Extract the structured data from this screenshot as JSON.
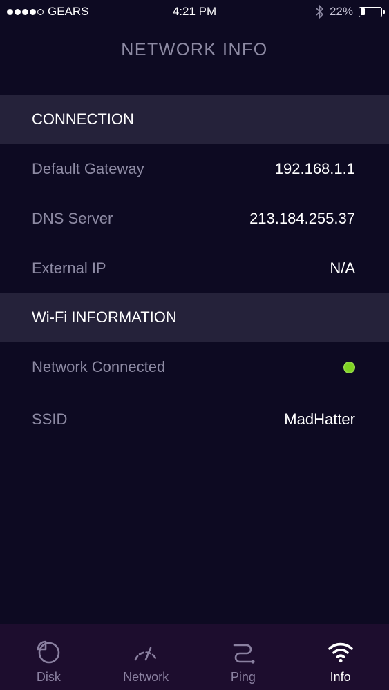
{
  "status_bar": {
    "carrier": "GEARS",
    "time": "4:21 PM",
    "battery_percent": "22%",
    "battery_level": 0.22,
    "signal_bars_filled": 4,
    "signal_bars_total": 5,
    "bluetooth_icon": "bluetooth-icon"
  },
  "header": {
    "title": "NETWORK INFO"
  },
  "connection": {
    "title": "CONNECTION",
    "rows": [
      {
        "label": "Default Gateway",
        "value": "192.168.1.1"
      },
      {
        "label": "DNS Server",
        "value": "213.184.255.37"
      },
      {
        "label": "External IP",
        "value": "N/A"
      }
    ]
  },
  "wifi": {
    "title": "Wi-Fi INFORMATION",
    "network_connected_label": "Network Connected",
    "network_connected": true,
    "status_color": "#7ed321",
    "ssid_label": "SSID",
    "ssid_value": "MadHatter"
  },
  "tab_bar": {
    "active": "Info",
    "tabs": [
      {
        "label": "Disk",
        "icon": "pie-chart-icon"
      },
      {
        "label": "Network",
        "icon": "speedometer-icon"
      },
      {
        "label": "Ping",
        "icon": "route-icon"
      },
      {
        "label": "Info",
        "icon": "wifi-icon"
      }
    ]
  },
  "colors": {
    "background": "#0d0a22",
    "section_header": "#25223a",
    "tab_bar": "#1d0d2e",
    "muted_text": "#8e8ba4"
  }
}
